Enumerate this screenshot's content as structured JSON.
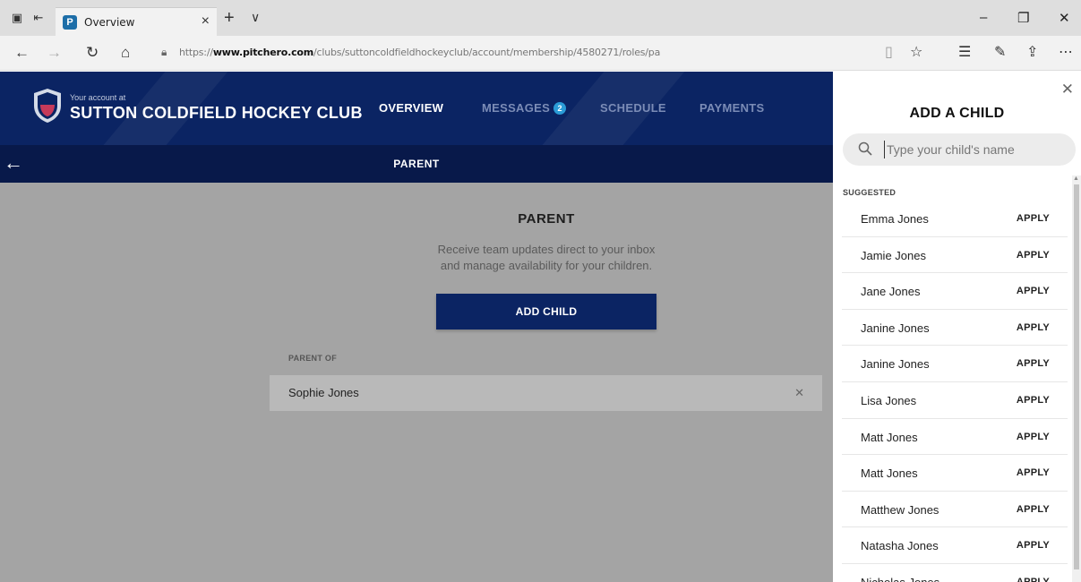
{
  "browser": {
    "tab_title": "Overview",
    "tab_close": "×",
    "new_tab": "+",
    "tab_menu": "∨",
    "url_prefix": "https://",
    "url_host": "www.pitchero.com",
    "url_path": "/clubs/suttoncoldfieldhockeyclub/account/membership/4580271/roles/pa",
    "minimize": "–",
    "restore": "❐",
    "close": "✕"
  },
  "header": {
    "account_at": "Your account at",
    "club_name": "SUTTON COLDFIELD HOCKEY CLUB",
    "nav": {
      "overview": "OVERVIEW",
      "messages": "MESSAGES",
      "messages_count": "2",
      "schedule": "SCHEDULE",
      "payments": "PAYMENTS"
    },
    "subbar_title": "PARENT"
  },
  "main": {
    "title": "PARENT",
    "desc_line1": "Receive team updates direct to your inbox",
    "desc_line2": "and manage availability for your children.",
    "add_child_label": "ADD CHILD",
    "parent_of_label": "PARENT OF",
    "children": [
      "Sophie Jones"
    ]
  },
  "panel": {
    "title": "ADD A CHILD",
    "search_placeholder": "Type your child's name",
    "suggested_label": "SUGGESTED",
    "apply_label": "APPLY",
    "suggestions": [
      "Emma Jones",
      "Jamie Jones",
      "Jane Jones",
      "Janine Jones",
      "Janine Jones",
      "Lisa Jones",
      "Matt Jones",
      "Matt Jones",
      "Matthew Jones",
      "Natasha Jones",
      "Nicholas Jones"
    ]
  },
  "colors": {
    "header_navy": "#0b2463",
    "subbar_navy": "#08194a",
    "badge_blue": "#2a9bd6",
    "overlay_gray": "#a4a4a4"
  }
}
